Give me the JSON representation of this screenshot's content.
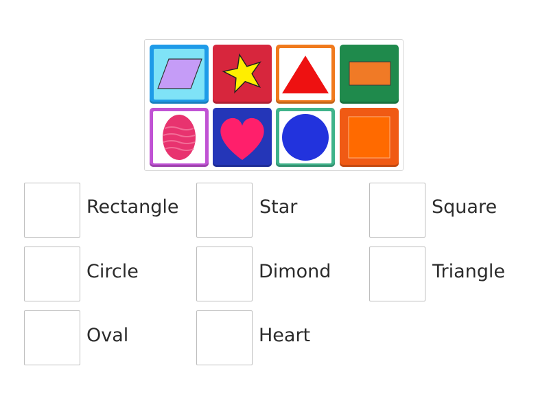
{
  "tiles": [
    {
      "shape": "parallelogram-icon",
      "frame": "#1e9be8",
      "inner": "#7fe3f7",
      "fill": "#c59cf7"
    },
    {
      "shape": "star-icon",
      "frame": "#d7263d",
      "inner": "#d7263d",
      "fill": "#ffee00"
    },
    {
      "shape": "triangle-icon",
      "frame": "#f07a1d",
      "inner": "#ffffff",
      "fill": "#ee1111"
    },
    {
      "shape": "rectangle-icon",
      "frame": "#1f8a4c",
      "inner": "#1f8a4c",
      "fill": "#f07a26"
    },
    {
      "shape": "oval-icon",
      "frame": "#c052d4",
      "inner": "#ffffff",
      "fill": "#e8336f"
    },
    {
      "shape": "heart-icon",
      "frame": "#2436b8",
      "inner": "#2436b8",
      "fill": "#ff1f6b"
    },
    {
      "shape": "circle-icon",
      "frame": "#3fb38a",
      "inner": "#ffffff",
      "fill": "#2233dd"
    },
    {
      "shape": "square-icon",
      "frame": "#f05a14",
      "inner": "#f05a14",
      "fill": "#ff6a00"
    }
  ],
  "labels": {
    "rectangle": "Rectangle",
    "star": "Star",
    "square": "Square",
    "circle": "Circle",
    "dimond": "Dimond",
    "triangle": "Triangle",
    "oval": "Oval",
    "heart": "Heart"
  }
}
